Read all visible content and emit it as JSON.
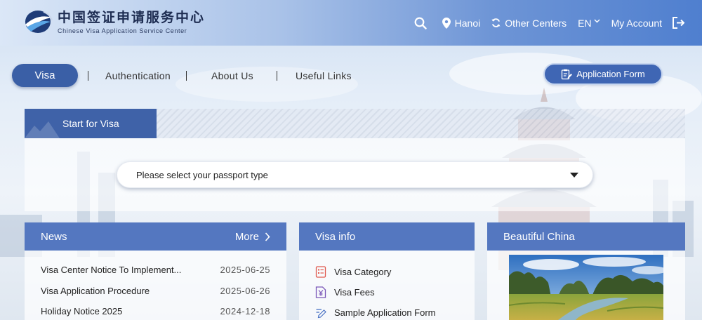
{
  "brand": {
    "name_cn": "中国签证申请服务中心",
    "name_en": "Chinese Visa Application Service Center"
  },
  "header": {
    "location": "Hanoi",
    "other_centers": "Other Centers",
    "language": "EN",
    "my_account": "My Account"
  },
  "nav": {
    "items": [
      "Visa",
      "Authentication",
      "About Us",
      "Useful Links"
    ],
    "active": "Visa",
    "application_form": "Application Form"
  },
  "start_visa": {
    "tab_label": "Start for Visa",
    "passport_select": "Please select your passport type"
  },
  "news": {
    "title": "News",
    "more": "More",
    "items": [
      {
        "title": "Visa Center Notice To Implement...",
        "date": "2025-06-25"
      },
      {
        "title": "Visa Application Procedure",
        "date": "2025-06-26"
      },
      {
        "title": "Holiday Notice 2025",
        "date": "2024-12-18"
      }
    ]
  },
  "visa_info": {
    "title": "Visa info",
    "items": [
      {
        "label": "Visa Category",
        "icon": "list-document-icon"
      },
      {
        "label": "Visa Fees",
        "icon": "yuan-document-icon"
      },
      {
        "label": "Sample Application Form",
        "icon": "pencil-form-icon"
      }
    ]
  },
  "beautiful_china": {
    "title": "Beautiful China"
  },
  "colors": {
    "primary": "#3a5fa6",
    "card_header": "#5477c0",
    "icon_red": "#e05a4f",
    "icon_purple": "#7b58b8",
    "icon_blue": "#4a72c4"
  }
}
